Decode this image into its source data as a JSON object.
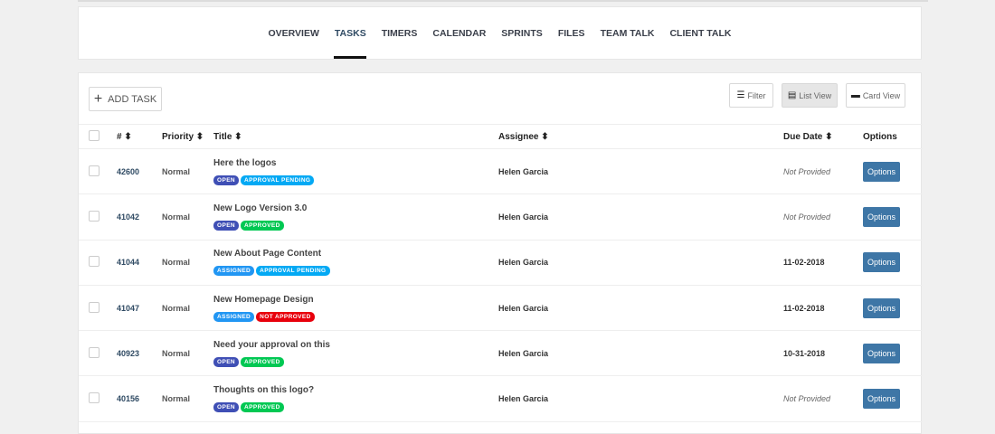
{
  "nav": {
    "tabs": [
      "OVERVIEW",
      "TASKS",
      "TIMERS",
      "CALENDAR",
      "SPRINTS",
      "FILES",
      "TEAM TALK",
      "CLIENT TALK"
    ],
    "active": "TASKS"
  },
  "toolbar": {
    "add_task": "ADD TASK",
    "filter": "Filter",
    "list_view": "List View",
    "card_view": "Card View"
  },
  "table": {
    "headers": {
      "id": "#",
      "priority": "Priority",
      "title": "Title",
      "assignee": "Assignee",
      "due": "Due Date",
      "options": "Options"
    },
    "rows": [
      {
        "id": "42600",
        "priority": "Normal",
        "title": "Here the logos",
        "status": "OPEN",
        "approval": "APPROVAL PENDING",
        "assignee": "Helen Garcia",
        "due": "Not Provided",
        "option": "Options"
      },
      {
        "id": "41042",
        "priority": "Normal",
        "title": "New Logo Version 3.0",
        "status": "OPEN",
        "approval": "APPROVED",
        "assignee": "Helen Garcia",
        "due": "Not Provided",
        "option": "Options"
      },
      {
        "id": "41044",
        "priority": "Normal",
        "title": "New About Page Content",
        "status": "ASSIGNED",
        "approval": "APPROVAL PENDING",
        "assignee": "Helen Garcia",
        "due": "11-02-2018",
        "option": "Options"
      },
      {
        "id": "41047",
        "priority": "Normal",
        "title": "New Homepage Design",
        "status": "ASSIGNED",
        "approval": "NOT APPROVED",
        "assignee": "Helen Garcia",
        "due": "11-02-2018",
        "option": "Options"
      },
      {
        "id": "40923",
        "priority": "Normal",
        "title": "Need your approval on this",
        "status": "OPEN",
        "approval": "APPROVED",
        "assignee": "Helen Garcia",
        "due": "10-31-2018",
        "option": "Options"
      },
      {
        "id": "40156",
        "priority": "Normal",
        "title": "Thoughts on this logo?",
        "status": "OPEN",
        "approval": "APPROVED",
        "assignee": "Helen Garcia",
        "due": "Not Provided",
        "option": "Options"
      }
    ]
  },
  "colors": {
    "OPEN": "#3f4fb5",
    "ASSIGNED": "#2196f3",
    "APPROVAL PENDING": "#03a9f4",
    "APPROVED": "#00c853",
    "NOT APPROVED": "#e8000c"
  }
}
